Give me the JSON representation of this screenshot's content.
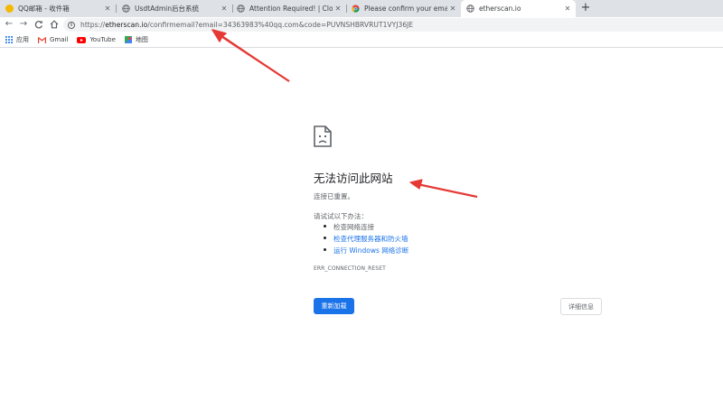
{
  "tabs": [
    {
      "title": "QQ邮箱 - 收件箱",
      "favicon": "qq-mail-icon",
      "favicon_color": "#e8a000",
      "active": false
    },
    {
      "title": "UsdtAdmin后台系统",
      "favicon": "globe-icon",
      "favicon_color": "#5f6368",
      "active": false
    },
    {
      "title": "Attention Required! | Cloudflare",
      "favicon": "globe-icon",
      "favicon_color": "#5f6368",
      "active": false
    },
    {
      "title": "Please confirm your email [Ether",
      "favicon": "chrome-icon",
      "favicon_color": "#4285f4",
      "active": false
    },
    {
      "title": "etherscan.io",
      "favicon": "globe-icon",
      "favicon_color": "#5f6368",
      "active": true
    }
  ],
  "tab_close_label": "✕",
  "new_tab_label": "+",
  "toolbar": {
    "back": "←",
    "forward": "→",
    "reload": "C",
    "home": "⌂",
    "info": "i",
    "url_prefix": "https://",
    "url_host": "etherscan.io",
    "url_path": "/confirmemail?email=34363983%40qq.com&code=PUVNSHBRVRUT1VYJ36JE"
  },
  "bookmarks": [
    {
      "label": "应用",
      "icon": "apps-grid-icon"
    },
    {
      "label": "Gmail",
      "icon": "gmail-icon"
    },
    {
      "label": "YouTube",
      "icon": "youtube-icon"
    },
    {
      "label": "地图",
      "icon": "maps-icon"
    }
  ],
  "error": {
    "title": "无法访问此网站",
    "subtitle": "连接已重置。",
    "try_label": "请试试以下办法：",
    "suggestions": [
      {
        "text": "检查网络连接",
        "link": false
      },
      {
        "text": "检查代理服务器和防火墙",
        "link": true
      },
      {
        "text": "运行 Windows 网络诊断",
        "link": true
      }
    ],
    "code": "ERR_CONNECTION_RESET",
    "reload_label": "重新加载",
    "details_label": "详细信息"
  },
  "colors": {
    "accent": "#1a73e8",
    "annotation_arrow": "#e53935"
  }
}
